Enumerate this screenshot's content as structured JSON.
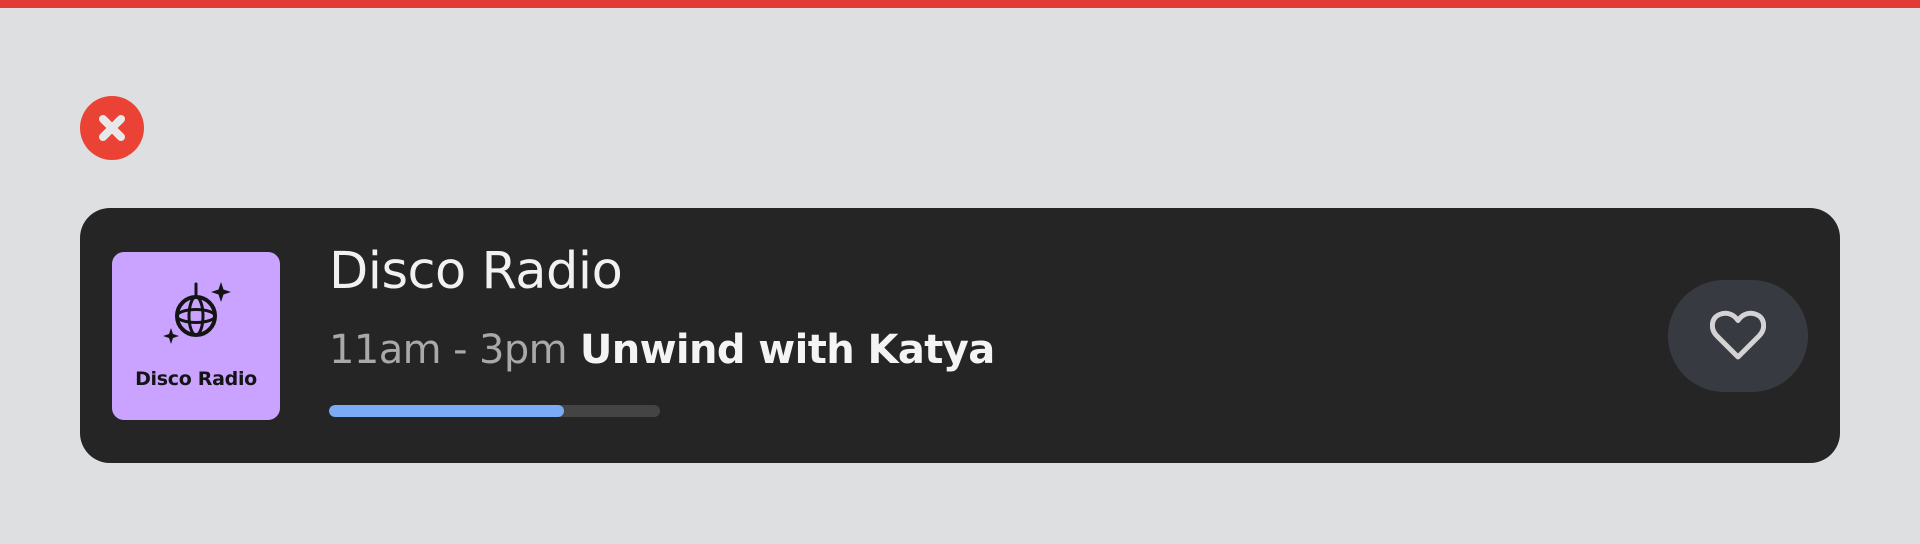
{
  "window": {
    "accent_color": "#e23a35"
  },
  "close_button": {
    "icon": "close-icon",
    "color": "#ea4335"
  },
  "station": {
    "name": "Disco Radio",
    "art_label": "Disco Radio",
    "art_icon": "disco-ball-icon",
    "art_color": "#c9a3ff",
    "time_range": "11am - 3pm",
    "show_name": "Unwind with Katya",
    "progress_fraction": 0.71,
    "progress_color": "#7baaf7"
  },
  "favorite_button": {
    "icon": "heart-outline-icon"
  }
}
